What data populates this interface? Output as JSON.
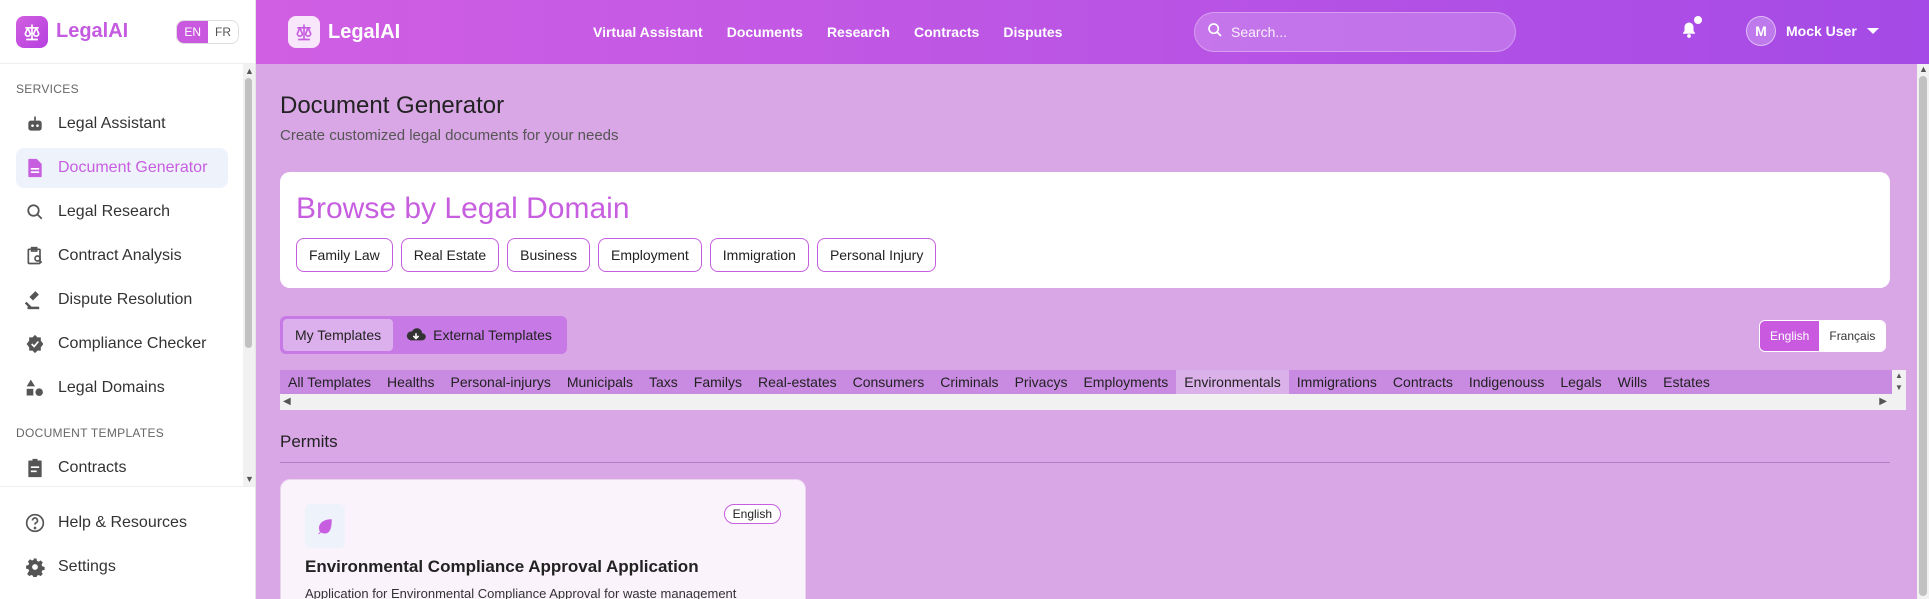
{
  "brand": {
    "name": "LegalAI"
  },
  "sidebar": {
    "lang_en": "EN",
    "lang_fr": "FR",
    "section_services": "SERVICES",
    "items": [
      {
        "label": "Legal Assistant",
        "icon": "robot-icon"
      },
      {
        "label": "Document Generator",
        "icon": "document-icon",
        "active": true
      },
      {
        "label": "Legal Research",
        "icon": "search-icon"
      },
      {
        "label": "Contract Analysis",
        "icon": "clipboard-search-icon"
      },
      {
        "label": "Dispute Resolution",
        "icon": "gavel-icon"
      },
      {
        "label": "Compliance Checker",
        "icon": "verified-badge-icon"
      },
      {
        "label": "Legal Domains",
        "icon": "shapes-icon"
      }
    ],
    "section_templates": "DOCUMENT TEMPLATES",
    "template_items": [
      {
        "label": "Contracts",
        "icon": "clipboard-icon"
      }
    ],
    "footer": [
      {
        "label": "Help & Resources",
        "icon": "help-circle-icon"
      },
      {
        "label": "Settings",
        "icon": "gear-icon"
      }
    ]
  },
  "topbar": {
    "nav": [
      "Virtual Assistant",
      "Documents",
      "Research",
      "Contracts",
      "Disputes"
    ],
    "search_placeholder": "Search...",
    "user_initial": "M",
    "user_name": "Mock User"
  },
  "main": {
    "title": "Document Generator",
    "subtitle": "Create customized legal documents for your needs",
    "domain_title": "Browse by Legal Domain",
    "domains": [
      "Family Law",
      "Real Estate",
      "Business",
      "Employment",
      "Immigration",
      "Personal Injury"
    ],
    "template_tabs": {
      "mine": "My Templates",
      "external": "External Templates"
    },
    "language": {
      "english": "English",
      "french": "Français"
    },
    "categories": [
      "All Templates",
      "Healths",
      "Personal-injurys",
      "Municipals",
      "Taxs",
      "Familys",
      "Real-estates",
      "Consumers",
      "Criminals",
      "Privacys",
      "Employments",
      "Environmentals",
      "Immigrations",
      "Contracts",
      "Indigenouss",
      "Legals",
      "Wills",
      "Estates"
    ],
    "active_category": "Environmentals",
    "section": "Permits",
    "card": {
      "badge": "English",
      "title": "Environmental Compliance Approval Application",
      "description": "Application for Environmental Compliance Approval for waste management"
    }
  },
  "colors": {
    "accent": "#c75ee0",
    "background": "#d9a6e6",
    "topbar_start": "#d05fe3",
    "topbar_end": "#a54ae6"
  }
}
